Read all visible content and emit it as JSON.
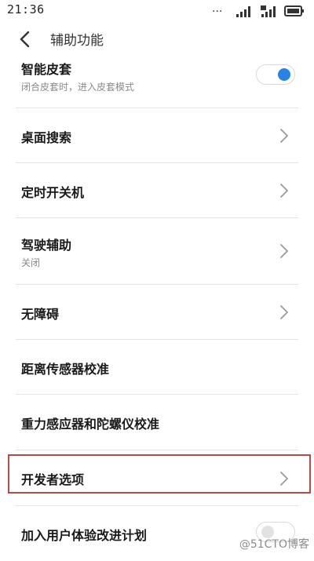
{
  "status_bar": {
    "time": "21:36",
    "dots": "..."
  },
  "header": {
    "title": "辅助功能"
  },
  "items": [
    {
      "title": "智能皮套",
      "subtitle": "闭合皮套时，进入皮套模式",
      "control": "toggle",
      "state": "on"
    },
    {
      "title": "桌面搜索",
      "control": "chevron"
    },
    {
      "title": "定时开关机",
      "control": "chevron"
    },
    {
      "title": "驾驶辅助",
      "subtitle": "关闭",
      "control": "chevron"
    },
    {
      "title": "无障碍",
      "control": "chevron"
    },
    {
      "title": "距离传感器校准",
      "control": "none"
    },
    {
      "title": "重力感应器和陀螺仪校准",
      "control": "none"
    },
    {
      "title": "开发者选项",
      "control": "chevron",
      "highlighted": true
    },
    {
      "title": "加入用户体验改进计划",
      "control": "toggle",
      "state": "off"
    }
  ],
  "watermark": "@51CTO博客",
  "colors": {
    "accent": "#2a82e4",
    "highlight_border": "#b44a4a"
  }
}
